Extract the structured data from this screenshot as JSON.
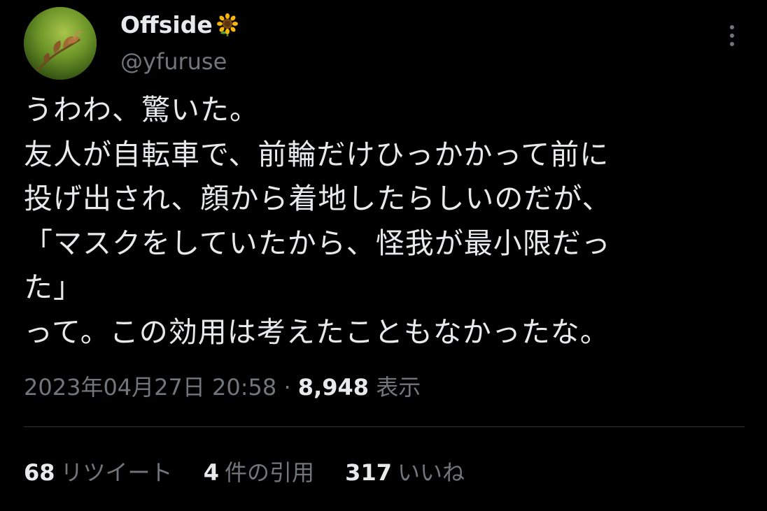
{
  "author": {
    "display_name": "Offside",
    "name_emoji": "sunflower-icon",
    "handle": "@yfuruse"
  },
  "tweet": {
    "lines": [
      "うわわ、驚いた。",
      "友人が自転車で、前輪だけひっかかって前に",
      "投げ出され、顔から着地したらしいのだが、",
      "「マスクをしていたから、怪我が最小限だっ",
      "た」",
      "って。この効用は考えたこともなかったな。"
    ],
    "timestamp": "2023年04月27日 20:58",
    "separator": "·",
    "views_count": "8,948",
    "views_label": "表示"
  },
  "stats": {
    "retweets_count": "68",
    "retweets_label": "リツイート",
    "quotes_count": "4",
    "quotes_label": "件の引用",
    "likes_count": "317",
    "likes_label": "いいね"
  },
  "colors": {
    "background": "#000000",
    "primary_text": "#e7e9ea",
    "secondary_text": "#71767b",
    "divider": "#2f3336"
  }
}
